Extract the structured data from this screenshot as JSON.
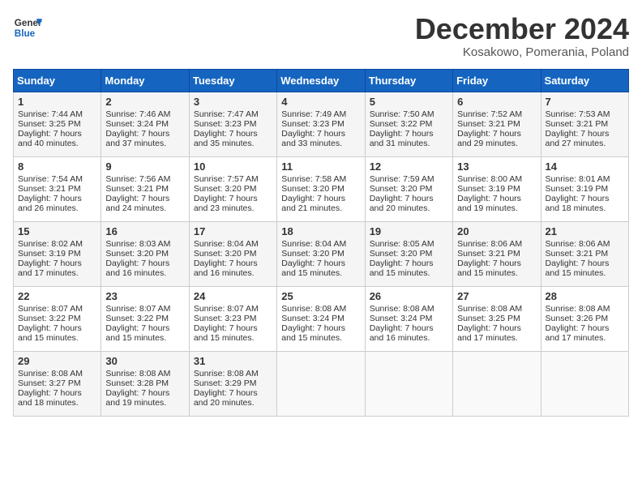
{
  "header": {
    "logo_line1": "General",
    "logo_line2": "Blue",
    "month": "December 2024",
    "location": "Kosakowo, Pomerania, Poland"
  },
  "days_of_week": [
    "Sunday",
    "Monday",
    "Tuesday",
    "Wednesday",
    "Thursday",
    "Friday",
    "Saturday"
  ],
  "weeks": [
    [
      {
        "day": "1",
        "sunrise": "Sunrise: 7:44 AM",
        "sunset": "Sunset: 3:25 PM",
        "daylight": "Daylight: 7 hours and 40 minutes."
      },
      {
        "day": "2",
        "sunrise": "Sunrise: 7:46 AM",
        "sunset": "Sunset: 3:24 PM",
        "daylight": "Daylight: 7 hours and 37 minutes."
      },
      {
        "day": "3",
        "sunrise": "Sunrise: 7:47 AM",
        "sunset": "Sunset: 3:23 PM",
        "daylight": "Daylight: 7 hours and 35 minutes."
      },
      {
        "day": "4",
        "sunrise": "Sunrise: 7:49 AM",
        "sunset": "Sunset: 3:23 PM",
        "daylight": "Daylight: 7 hours and 33 minutes."
      },
      {
        "day": "5",
        "sunrise": "Sunrise: 7:50 AM",
        "sunset": "Sunset: 3:22 PM",
        "daylight": "Daylight: 7 hours and 31 minutes."
      },
      {
        "day": "6",
        "sunrise": "Sunrise: 7:52 AM",
        "sunset": "Sunset: 3:21 PM",
        "daylight": "Daylight: 7 hours and 29 minutes."
      },
      {
        "day": "7",
        "sunrise": "Sunrise: 7:53 AM",
        "sunset": "Sunset: 3:21 PM",
        "daylight": "Daylight: 7 hours and 27 minutes."
      }
    ],
    [
      {
        "day": "8",
        "sunrise": "Sunrise: 7:54 AM",
        "sunset": "Sunset: 3:21 PM",
        "daylight": "Daylight: 7 hours and 26 minutes."
      },
      {
        "day": "9",
        "sunrise": "Sunrise: 7:56 AM",
        "sunset": "Sunset: 3:21 PM",
        "daylight": "Daylight: 7 hours and 24 minutes."
      },
      {
        "day": "10",
        "sunrise": "Sunrise: 7:57 AM",
        "sunset": "Sunset: 3:20 PM",
        "daylight": "Daylight: 7 hours and 23 minutes."
      },
      {
        "day": "11",
        "sunrise": "Sunrise: 7:58 AM",
        "sunset": "Sunset: 3:20 PM",
        "daylight": "Daylight: 7 hours and 21 minutes."
      },
      {
        "day": "12",
        "sunrise": "Sunrise: 7:59 AM",
        "sunset": "Sunset: 3:20 PM",
        "daylight": "Daylight: 7 hours and 20 minutes."
      },
      {
        "day": "13",
        "sunrise": "Sunrise: 8:00 AM",
        "sunset": "Sunset: 3:19 PM",
        "daylight": "Daylight: 7 hours and 19 minutes."
      },
      {
        "day": "14",
        "sunrise": "Sunrise: 8:01 AM",
        "sunset": "Sunset: 3:19 PM",
        "daylight": "Daylight: 7 hours and 18 minutes."
      }
    ],
    [
      {
        "day": "15",
        "sunrise": "Sunrise: 8:02 AM",
        "sunset": "Sunset: 3:19 PM",
        "daylight": "Daylight: 7 hours and 17 minutes."
      },
      {
        "day": "16",
        "sunrise": "Sunrise: 8:03 AM",
        "sunset": "Sunset: 3:20 PM",
        "daylight": "Daylight: 7 hours and 16 minutes."
      },
      {
        "day": "17",
        "sunrise": "Sunrise: 8:04 AM",
        "sunset": "Sunset: 3:20 PM",
        "daylight": "Daylight: 7 hours and 16 minutes."
      },
      {
        "day": "18",
        "sunrise": "Sunrise: 8:04 AM",
        "sunset": "Sunset: 3:20 PM",
        "daylight": "Daylight: 7 hours and 15 minutes."
      },
      {
        "day": "19",
        "sunrise": "Sunrise: 8:05 AM",
        "sunset": "Sunset: 3:20 PM",
        "daylight": "Daylight: 7 hours and 15 minutes."
      },
      {
        "day": "20",
        "sunrise": "Sunrise: 8:06 AM",
        "sunset": "Sunset: 3:21 PM",
        "daylight": "Daylight: 7 hours and 15 minutes."
      },
      {
        "day": "21",
        "sunrise": "Sunrise: 8:06 AM",
        "sunset": "Sunset: 3:21 PM",
        "daylight": "Daylight: 7 hours and 15 minutes."
      }
    ],
    [
      {
        "day": "22",
        "sunrise": "Sunrise: 8:07 AM",
        "sunset": "Sunset: 3:22 PM",
        "daylight": "Daylight: 7 hours and 15 minutes."
      },
      {
        "day": "23",
        "sunrise": "Sunrise: 8:07 AM",
        "sunset": "Sunset: 3:22 PM",
        "daylight": "Daylight: 7 hours and 15 minutes."
      },
      {
        "day": "24",
        "sunrise": "Sunrise: 8:07 AM",
        "sunset": "Sunset: 3:23 PM",
        "daylight": "Daylight: 7 hours and 15 minutes."
      },
      {
        "day": "25",
        "sunrise": "Sunrise: 8:08 AM",
        "sunset": "Sunset: 3:24 PM",
        "daylight": "Daylight: 7 hours and 15 minutes."
      },
      {
        "day": "26",
        "sunrise": "Sunrise: 8:08 AM",
        "sunset": "Sunset: 3:24 PM",
        "daylight": "Daylight: 7 hours and 16 minutes."
      },
      {
        "day": "27",
        "sunrise": "Sunrise: 8:08 AM",
        "sunset": "Sunset: 3:25 PM",
        "daylight": "Daylight: 7 hours and 17 minutes."
      },
      {
        "day": "28",
        "sunrise": "Sunrise: 8:08 AM",
        "sunset": "Sunset: 3:26 PM",
        "daylight": "Daylight: 7 hours and 17 minutes."
      }
    ],
    [
      {
        "day": "29",
        "sunrise": "Sunrise: 8:08 AM",
        "sunset": "Sunset: 3:27 PM",
        "daylight": "Daylight: 7 hours and 18 minutes."
      },
      {
        "day": "30",
        "sunrise": "Sunrise: 8:08 AM",
        "sunset": "Sunset: 3:28 PM",
        "daylight": "Daylight: 7 hours and 19 minutes."
      },
      {
        "day": "31",
        "sunrise": "Sunrise: 8:08 AM",
        "sunset": "Sunset: 3:29 PM",
        "daylight": "Daylight: 7 hours and 20 minutes."
      },
      null,
      null,
      null,
      null
    ]
  ]
}
